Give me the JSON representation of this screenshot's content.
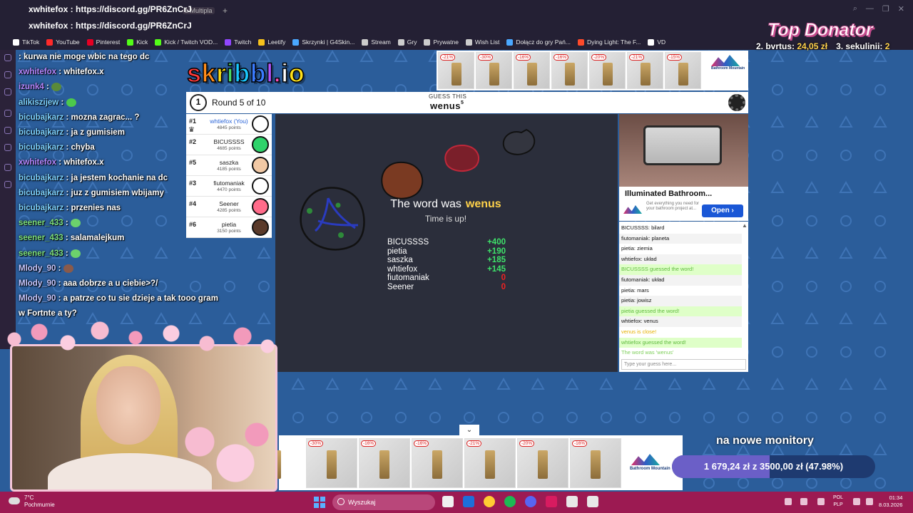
{
  "browser": {
    "url_primary": "xwhitefox : https://discord.gg/PR6ZnCrJ",
    "url_secondary": "xwhitefox : https://discord.gg/PR6ZnCrJ",
    "tab_label": "e Multipla",
    "tab_plus": "+",
    "window_controls": [
      "⌕",
      "—",
      "❐",
      "✕"
    ],
    "bookmarks": [
      {
        "label": "TikTok",
        "color": "#ffffff"
      },
      {
        "label": "YouTube",
        "color": "#ff2a2a"
      },
      {
        "label": "Pinterest",
        "color": "#e60023"
      },
      {
        "label": "Kick",
        "color": "#53fc18"
      },
      {
        "label": "Kick / Twitch VOD...",
        "color": "#53fc18"
      },
      {
        "label": "Twitch",
        "color": "#9146ff"
      },
      {
        "label": "Leetify",
        "color": "#f7c21c"
      },
      {
        "label": "Skrzynki | G4Skin...",
        "color": "#4aa8ff"
      },
      {
        "label": "Stream",
        "color": "#cccccc"
      },
      {
        "label": "Gry",
        "color": "#cccccc"
      },
      {
        "label": "Prywatne",
        "color": "#cccccc"
      },
      {
        "label": "Wish List",
        "color": "#cccccc"
      },
      {
        "label": "Dołącz do gry Pań...",
        "color": "#4aa8ff"
      },
      {
        "label": "Dying Light: The F...",
        "color": "#ff4a2a"
      },
      {
        "label": "VD",
        "color": "#ffffff"
      }
    ]
  },
  "stream_chat": [
    {
      "user": "",
      "text": ": kurwa nie moge wbic na tego dc",
      "user_color": "#ff4a6a"
    },
    {
      "user": "xwhitefox",
      "text": ": whitefox.x",
      "user_color": "#b887ff"
    },
    {
      "user": "izunk4",
      "text": ":",
      "user_color": "#b887ff",
      "emote": "#5a8a3a"
    },
    {
      "user": "alikiszijew",
      "text": ":",
      "user_color": "#7fd3ff",
      "emote": "#4cc94c"
    },
    {
      "user": "bicubajkarz",
      "text": ": mozna zagrac... ?",
      "user_color": "#7fd3ff"
    },
    {
      "user": "bicubajkarz",
      "text": ": ja z gumisiem",
      "user_color": "#7fd3ff"
    },
    {
      "user": "bicubajkarz",
      "text": ": chyba",
      "user_color": "#7fd3ff"
    },
    {
      "user": "xwhitefox",
      "text": ": whitefox.x",
      "user_color": "#b887ff"
    },
    {
      "user": "bicubajkarz",
      "text": ": ja jestem kochanie na dc",
      "user_color": "#7fd3ff"
    },
    {
      "user": "bicubajkarz",
      "text": ": juz z gumisiem wbijamy",
      "user_color": "#7fd3ff"
    },
    {
      "user": "bicubajkarz",
      "text": ": przenies nas",
      "user_color": "#7fd3ff"
    },
    {
      "user": "seener_433",
      "text": ":",
      "user_color": "#7ee07e",
      "emote": "#6cd16c"
    },
    {
      "user": "seener_433",
      "text": ": salamalejkum",
      "user_color": "#7ee07e"
    },
    {
      "user": "seener_433",
      "text": ":",
      "user_color": "#7ee07e",
      "emote": "#6cd16c"
    },
    {
      "user": "Mlody_90",
      "text": ":",
      "user_color": "#c7c7ff",
      "emote": "#8a5a4a"
    },
    {
      "user": "Mlody_90",
      "text": ": aaa dobrze a u ciebie>?/",
      "user_color": "#c7c7ff"
    },
    {
      "user": "Mlody_90",
      "text": ": a patrze co tu sie dzieje a tak tooo gram",
      "user_color": "#c7c7ff"
    },
    {
      "user": "",
      "text": "w Fortnte a ty?",
      "user_color": "#c7c7ff"
    }
  ],
  "donator": {
    "title": "Top Donator",
    "entries": [
      {
        "rank": "2.",
        "name": "bvrtus:",
        "amount": "24,05 zł"
      },
      {
        "rank": "3.",
        "name": "sekulinii:",
        "amount": "2"
      }
    ]
  },
  "game": {
    "logo": "skribbl.io",
    "logo_colors": [
      "#ff3b3b",
      "#ff8c1a",
      "#ffe11a",
      "#4cd964",
      "#1ac8ff",
      "#3a7bff",
      "#b455ff",
      "#ff4fb6",
      "#ffffff",
      "#ffe11a"
    ],
    "round_clock": "1",
    "round_text": "Round 5 of 10",
    "guess_label": "GUESS THIS",
    "word_hint": "wenus",
    "word_length": "5",
    "players": [
      {
        "rank": "#1",
        "name": "whtiefox (You)",
        "points": "4845 points",
        "avatar_color": "#ffffff",
        "self": true
      },
      {
        "rank": "#2",
        "name": "BICUSSSS",
        "points": "4685 points",
        "avatar_color": "#2fd36b"
      },
      {
        "rank": "#5",
        "name": "saszka",
        "points": "4185 points",
        "avatar_color": "#f2c9a5"
      },
      {
        "rank": "#3",
        "name": "fiutomaniak",
        "points": "4470 points",
        "avatar_color": "#ffffff"
      },
      {
        "rank": "#4",
        "name": "Seener",
        "points": "4285 points",
        "avatar_color": "#ff6b8a"
      },
      {
        "rank": "#6",
        "name": "pietia",
        "points": "3150 points",
        "avatar_color": "#5a3a2a"
      }
    ],
    "crown_icon": "♛",
    "reveal_prefix": "The word was",
    "reveal_word": "wenus",
    "reveal_sub": "Time is up!",
    "results": [
      {
        "name": "BICUSSSS",
        "score": "+400"
      },
      {
        "name": "pietia",
        "score": "+190"
      },
      {
        "name": "saszka",
        "score": "+185"
      },
      {
        "name": "whtiefox",
        "score": "+145"
      },
      {
        "name": "fiutomaniak",
        "score": "0"
      },
      {
        "name": "Seener",
        "score": "0"
      }
    ],
    "guess_chat": [
      {
        "text": "BICUSSSS: bilard",
        "kind": "normal"
      },
      {
        "text": "fiutomaniak: planeta",
        "kind": "normal"
      },
      {
        "text": "pietia: ziemia",
        "kind": "normal"
      },
      {
        "text": "whtiefox: układ",
        "kind": "normal"
      },
      {
        "text": "BICUSSSS guessed the word!",
        "kind": "guessed"
      },
      {
        "text": "fiutomaniak: układ",
        "kind": "normal"
      },
      {
        "text": "pietia: mars",
        "kind": "normal"
      },
      {
        "text": "pietia: jowisz",
        "kind": "normal"
      },
      {
        "text": "pietia guessed the word!",
        "kind": "guessed"
      },
      {
        "text": "whtiefox: venus",
        "kind": "normal"
      },
      {
        "text": "venus is close!",
        "kind": "close"
      },
      {
        "text": "whtiefox guessed the word!",
        "kind": "guessed"
      },
      {
        "text": "The word was 'wenus'",
        "kind": "word"
      }
    ],
    "guess_placeholder": "Type your guess here...",
    "scroll_up_icon": "▲"
  },
  "ads": {
    "top_discounts": [
      "-21%",
      "-30%",
      "-16%",
      "-16%",
      "-20%",
      "-21%",
      "-15%"
    ],
    "brand": "Bathroom Mountain",
    "right_title": "Illuminated Bathroom...",
    "right_desc": "Get everything you need for your bathroom project at...",
    "right_button": "Open ›",
    "bottom_discounts": [
      "",
      "-30%",
      "-16%",
      "-16%",
      "-21%",
      "-20%",
      "-16%"
    ],
    "collapse_icon": "⌄"
  },
  "goal": {
    "title": "na nowe monitory",
    "text": "1 679,24 zł z 3500,00 zł (47.98%)",
    "progress_percent": 47.98,
    "fill_color": "#6b5fc7"
  },
  "taskbar": {
    "temperature": "7°C",
    "weather": "Pochmurnie",
    "search_label": "Wyszukaj",
    "lang_top": "POL",
    "lang_bottom": "PLP",
    "time": "01:34",
    "date": "8.03.2026",
    "apps": [
      "#f0f0f0",
      "#1e6fd9",
      "#ffcc33",
      "#1db954",
      "#5865f2",
      "#d81b60",
      "#e8e8e8",
      "#e8e8e8"
    ]
  }
}
